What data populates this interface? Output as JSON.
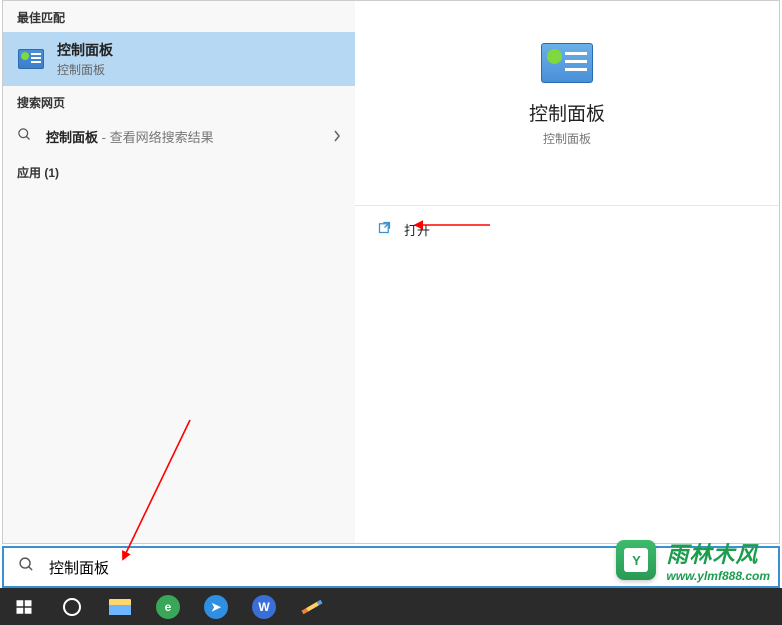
{
  "left": {
    "section_best": "最佳匹配",
    "best_result": {
      "title": "控制面板",
      "subtitle": "控制面板"
    },
    "section_web": "搜索网页",
    "web_result": {
      "bold": "控制面板",
      "suffix": " - 查看网络搜索结果"
    },
    "section_apps": "应用 (1)"
  },
  "preview": {
    "title": "控制面板",
    "subtitle": "控制面板",
    "action_open": "打开"
  },
  "searchbox": {
    "value": "控制面板"
  },
  "watermark": {
    "brand_cn": "雨林木风",
    "brand_url": "www.ylmf888.com",
    "logo_letter": "Y"
  },
  "icons": {
    "search": "search-icon",
    "chevron_right": "chevron-right-icon",
    "open": "open-external-icon",
    "start": "windows-start-icon",
    "cortana": "cortana-circle-icon",
    "explorer": "file-explorer-icon",
    "browser": "browser-360-icon",
    "app_blue": "thunder-icon",
    "wps": "wps-icon",
    "pencil": "pencil-icon"
  }
}
